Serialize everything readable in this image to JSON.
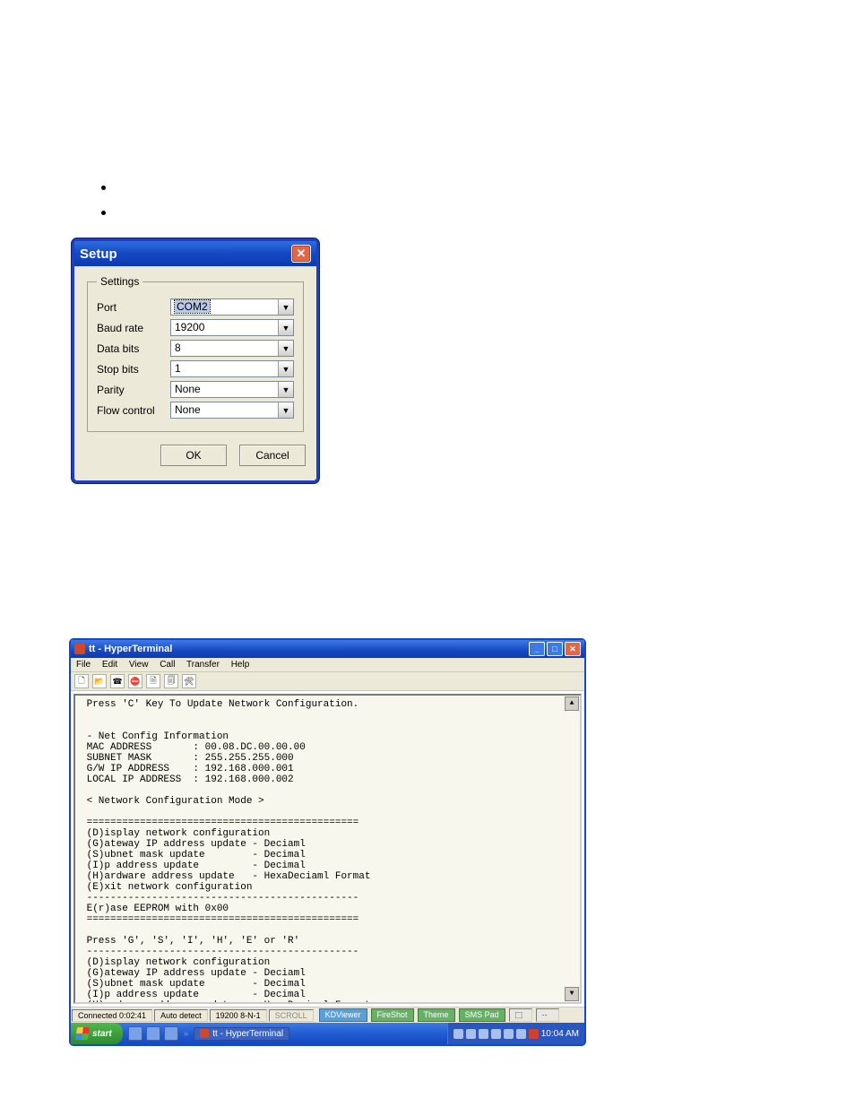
{
  "bullets": {
    "b1": "",
    "b2": ""
  },
  "setup": {
    "title": "Setup",
    "legend": "Settings",
    "rows": {
      "port": {
        "label": "Port",
        "value": "COM2"
      },
      "baud": {
        "label": "Baud rate",
        "value": "19200"
      },
      "databits": {
        "label": "Data bits",
        "value": "8"
      },
      "stopbits": {
        "label": "Stop bits",
        "value": "1"
      },
      "parity": {
        "label": "Parity",
        "value": "None"
      },
      "flow": {
        "label": "Flow control",
        "value": "None"
      }
    },
    "ok": "OK",
    "cancel": "Cancel"
  },
  "ht": {
    "title": "tt - HyperTerminal",
    "menu": {
      "file": "File",
      "edit": "Edit",
      "view": "View",
      "call": "Call",
      "transfer": "Transfer",
      "help": "Help"
    },
    "status": {
      "conn": "Connected 0:02:41",
      "detect": "Auto detect",
      "mode": "19200 8-N-1",
      "scroll": "SCROLL"
    },
    "statusbar_apps": {
      "a": "KDViewer",
      "b": "FireShot",
      "c": "Theme",
      "d": "SMS Pad"
    },
    "term": " Press 'C' Key To Update Network Configuration.\n\n\n - Net Config Information\n MAC ADDRESS       : 00.08.DC.00.00.00\n SUBNET MASK       : 255.255.255.000\n G/W IP ADDRESS    : 192.168.000.001\n LOCAL IP ADDRESS  : 192.168.000.002\n\n < Network Configuration Mode >\n\n ==============================================\n (D)isplay network configuration\n (G)ateway IP address update - Deciaml\n (S)ubnet mask update        - Decimal\n (I)p address update         - Decimal\n (H)ardware address update   - HexaDeciaml Format\n (E)xit network configuration\n ----------------------------------------------\n E(r)ase EEPROM with 0x00\n ==============================================\n\n Press 'G', 'S', 'I', 'H', 'E' or 'R'\n ----------------------------------------------\n (D)isplay network configuration\n (G)ateway IP address update - Deciaml\n (S)ubnet mask update        - Decimal\n (I)p address update         - Decimal\n (H)ardware address update   - HexaDeciaml Format\n (E)xit network configuration mode\n ----------------------------------------------\n E(r)ase EEPROM with 0x00\n ==============================================\n\n Press 'G', 'S', 'I', 'H', 'E' or 'R'"
  },
  "taskbar": {
    "start": "start",
    "task": "tt - HyperTerminal",
    "clock": "10:04 AM"
  }
}
